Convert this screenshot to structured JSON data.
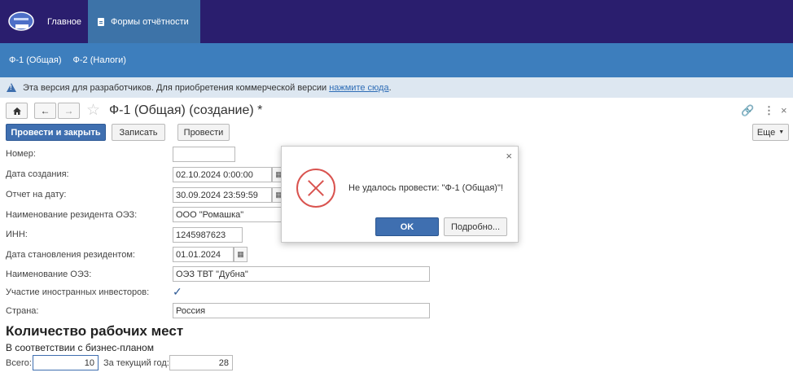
{
  "topbar": {
    "home_label": "Главное",
    "forms_label": "Формы отчётности",
    "colors": {
      "bg": "#2a1e6e",
      "active_tab": "#3d73a8"
    }
  },
  "subbar": {
    "items": [
      "Ф-1 (Общая)",
      "Ф-2 (Налоги)"
    ]
  },
  "infobar": {
    "text": "Эта версия для разработчиков. Для приобретения коммерческой версии",
    "link": "нажмите сюда",
    "suffix": "."
  },
  "navrow": {
    "title": "Ф-1 (Общая) (создание) *",
    "icons": [
      "home-icon",
      "back-arrow-icon",
      "forward-arrow-icon",
      "star-icon",
      "link-icon",
      "more-vertical-icon",
      "close-icon"
    ]
  },
  "toolbar": {
    "post_close_label": "Провести и закрыть",
    "save_label": "Записать",
    "post_label": "Провести",
    "more_label": "Еще"
  },
  "form": {
    "number_label": "Номер:",
    "number_value": "",
    "created_label": "Дата создания:",
    "created_value": "02.10.2024  0:00:00",
    "report_date_label": "Отчет на дату:",
    "report_date_value": "30.09.2024 23:59:59",
    "resident_name_label": "Наименование резидента ОЭЗ:",
    "resident_name_value": "ООО \"Ромашка\"",
    "inn_label": "ИНН:",
    "inn_value": "1245987623",
    "resident_date_label": "Дата становления резидентом:",
    "resident_date_value": "01.01.2024",
    "oez_name_label": "Наименование ОЭЗ:",
    "oez_name_value": "ОЭЗ ТВТ \"Дубна\"",
    "foreign_label": "Участие иностранных инвесторов:",
    "foreign_checked": true,
    "country_label": "Страна:",
    "country_value": "Россия"
  },
  "jobs": {
    "heading": "Количество рабочих мест",
    "subheading": "В соответствии с бизнес-планом",
    "total_label": "Всего:",
    "total_value": "10",
    "current_year_label": "За текущий год:",
    "current_year_value": "28"
  },
  "dialog": {
    "message": "Не удалось провести: \"Ф-1 (Общая)\"!",
    "ok_label": "OK",
    "details_label": "Подробно..."
  }
}
